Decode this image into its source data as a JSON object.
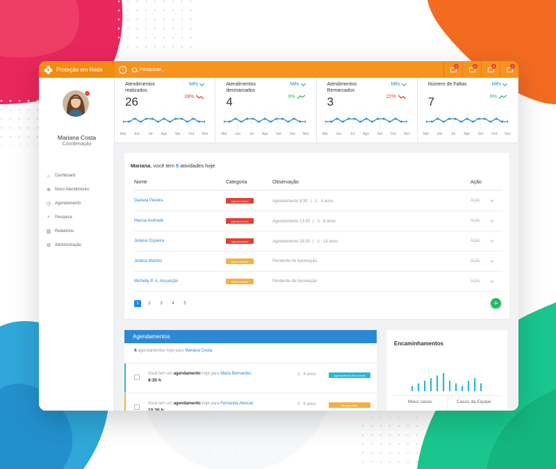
{
  "app": {
    "brand_name": "Proteção em Rede",
    "search_placeholder": "Pesquisar...",
    "top_icons": [
      {
        "name": "bell-icon",
        "badge": "9"
      },
      {
        "name": "chat-icon",
        "badge": "8"
      },
      {
        "name": "calendar-icon",
        "badge": "8"
      },
      {
        "name": "briefcase-icon",
        "badge": "2"
      }
    ],
    "accent_color": "#f7931e",
    "link_color": "#1e88e5"
  },
  "user": {
    "name": "Mariana Costa",
    "role": "Coordenação"
  },
  "sidebar": {
    "items": [
      {
        "label": "Dashboard",
        "icon": "home-icon"
      },
      {
        "label": "Novo Atendimento",
        "icon": "plus-circle-icon"
      },
      {
        "label": "Agendamento",
        "icon": "clock-icon"
      },
      {
        "label": "Pesquisa",
        "icon": "search-icon"
      },
      {
        "label": "Relatórios",
        "icon": "bar-chart-icon"
      },
      {
        "label": "Administração",
        "icon": "gear-icon"
      }
    ]
  },
  "stats": [
    {
      "label": "Atendimentos realizados",
      "value": "26",
      "period": "Mês",
      "change": "28%",
      "trend": "down"
    },
    {
      "label": "Atendimentos desmarcados",
      "value": "4",
      "period": "Mês",
      "change": "9%",
      "trend": "up"
    },
    {
      "label": "Atendimentos Remarcados",
      "value": "3",
      "period": "Mês",
      "change": "22%",
      "trend": "down"
    },
    {
      "label": "Número de Faltas",
      "value": "7",
      "period": "Mês",
      "change": "9%",
      "trend": "up"
    }
  ],
  "chart_data": {
    "type": "line",
    "x": [
      "Mai",
      "Jun",
      "Jul",
      "Ago",
      "Set",
      "Out",
      "Nov"
    ],
    "series": [
      {
        "values": [
          2,
          2,
          3,
          2,
          3,
          3,
          2,
          3,
          2,
          3,
          3,
          2,
          3,
          2,
          2
        ]
      },
      {
        "values": [
          2,
          2,
          3,
          2,
          3,
          3,
          2,
          3,
          2,
          3,
          3,
          2,
          3,
          2,
          2
        ]
      },
      {
        "values": [
          2,
          2,
          3,
          2,
          3,
          3,
          2,
          3,
          2,
          3,
          3,
          2,
          3,
          2,
          2
        ]
      },
      {
        "values": [
          2,
          2,
          3,
          2,
          3,
          3,
          2,
          3,
          2,
          3,
          3,
          2,
          3,
          2,
          2
        ]
      }
    ],
    "line_color": "#2b8ad6"
  },
  "activities": {
    "greeting_name": "Mariana",
    "greeting_mid": ", você tem ",
    "count": "5",
    "greeting_end": " atividades hoje",
    "columns": [
      "Nome",
      "Categoria",
      "Observação",
      "Ação"
    ],
    "rows": [
      {
        "name": "Daniela Pereira",
        "category": "Agendamento",
        "category_color": "#e53e30",
        "obs": "Agendamento 8:30",
        "age": "6 anos",
        "action": "Ação"
      },
      {
        "name": "Marcia Andrade",
        "category": "Agendamento",
        "category_color": "#e53e30",
        "obs": "Agendamento 13:30",
        "age": "8 anos",
        "action": "Ação"
      },
      {
        "name": "Juliana Ciqueira",
        "category": "Agendamento",
        "category_color": "#e53e30",
        "obs": "Agendamento 18:30",
        "age": "14 anos",
        "action": "Ação"
      },
      {
        "name": "Juliana Martins",
        "category": "Novo Usuário",
        "category_color": "#f5b041",
        "obs": "Pendente de Aprovação",
        "age": "",
        "action": "Ação"
      },
      {
        "name": "Michelly P. A. Assunção",
        "category": "Novo Usuário",
        "category_color": "#f5b041",
        "obs": "Pendente de Aprovação",
        "age": "",
        "action": "Ação"
      }
    ],
    "pages": [
      "1",
      "2",
      "3",
      "4",
      "5"
    ],
    "active_page": "1",
    "fab_label": "+"
  },
  "agenda": {
    "title": "Agendamentos",
    "count": "4",
    "sub_text": " agendamentos hoje para ",
    "sub_name": "Mariana Costa",
    "sub_end": ".",
    "items": [
      {
        "prefix": "Você tem um ",
        "kind": "agendamento",
        "mid": " hoje para ",
        "name": "Maria Bernardes",
        "end": ".",
        "time": "8:30 h",
        "age": "8 anos",
        "tag": "Agendamento Recorrente",
        "tag_color": "#29b6d8",
        "stripe": "#29b6d8"
      },
      {
        "prefix": "Você tem um ",
        "kind": "agendamento",
        "mid": " hoje para ",
        "name": "Fernanda Alencar",
        "end": ".",
        "time": "10:30 h",
        "age": "6 anos",
        "tag": "Reagendado",
        "tag_color": "#f5b041",
        "stripe": "#f5b041"
      }
    ]
  },
  "encaminhamentos": {
    "title": "Encaminhamentos",
    "bars": [
      2,
      3,
      4,
      5,
      6,
      7,
      4,
      3,
      2,
      4,
      5,
      3
    ],
    "tabs": [
      "Meus casos",
      "Casos da Equipe"
    ]
  }
}
